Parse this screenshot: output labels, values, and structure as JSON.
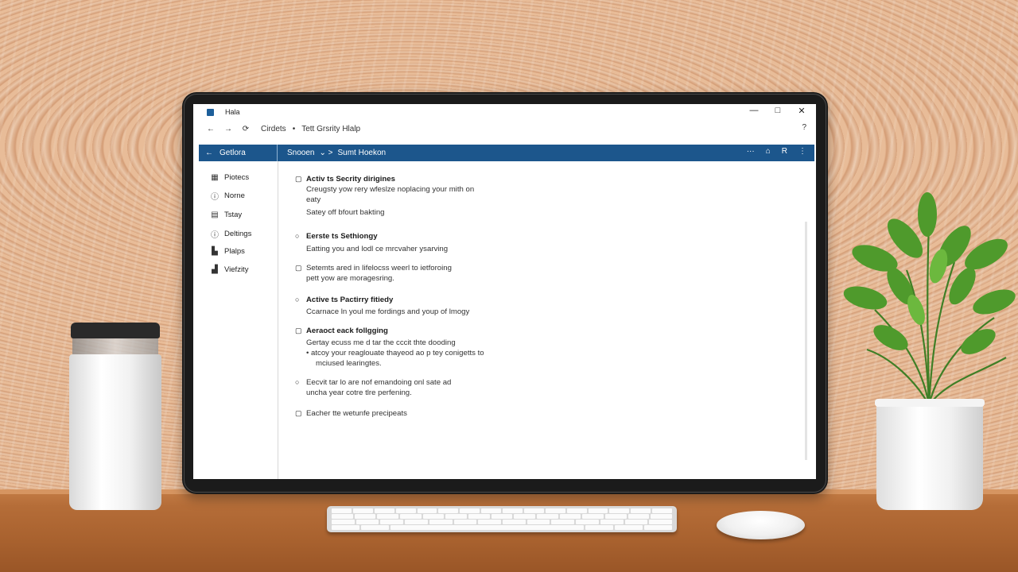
{
  "window": {
    "title": "Hala",
    "controls": {
      "minimize": "—",
      "maximize": "□",
      "close": "✕"
    }
  },
  "address": {
    "back": "←",
    "forward": "→",
    "refresh": "⟳",
    "path": [
      "Cirdets",
      "•",
      "Tett Grsrity Hlalp"
    ],
    "right_icon": "?"
  },
  "header": {
    "back": "←",
    "section": "Getlora",
    "crumbs": [
      "Snooen",
      "⌄ >",
      "Sumt Hoekon"
    ],
    "tools": [
      "···",
      "⌂",
      "R",
      "⋮"
    ]
  },
  "sidebar": {
    "items": [
      {
        "label": "Piotecs",
        "icon": "window-icon",
        "glyph": "▦"
      },
      {
        "label": "Norne",
        "icon": "info-icon",
        "glyph": "ⓘ"
      },
      {
        "label": "Tstay",
        "icon": "calendar-icon",
        "glyph": "▤"
      },
      {
        "label": "Deltings",
        "icon": "clock-icon",
        "glyph": "ⓘ"
      },
      {
        "label": "Plalps",
        "icon": "printer-icon",
        "glyph": "▙"
      },
      {
        "label": "Viefzity",
        "icon": "lock-icon",
        "glyph": "▟"
      }
    ]
  },
  "content": {
    "sections": [
      {
        "mark": "▢",
        "title": "Activ ts Secrity dirigines",
        "lines": [
          "Creugsty yow rery wfeslze noplacing your mith on",
          "eaty",
          "Satey off bfourt bakting"
        ]
      },
      {
        "mark": "○",
        "title": "Eerste ts Sethiongy",
        "lines": [
          "Eatting you and lodl ce mrcvaher ysarving"
        ]
      },
      {
        "mark": "▢",
        "title": "",
        "lines": [
          "Setemts ared in Iifelocss weerl to ietforoing",
          "pett yow are moragesring."
        ]
      },
      {
        "mark": "○",
        "title": "Active ts Pactirry fitiedy",
        "lines": [
          "Ccarnace ln youl me fordings and youp of lmogy"
        ]
      },
      {
        "mark": "▢",
        "title": "Aeraoct eack follgging",
        "lines": [
          "Gertay ecuss me d tar the cccit thte dooding"
        ],
        "bullets": [
          "atcoy your reaglouate thayeod ao p tey conigetts to",
          "mciused learingtes."
        ]
      },
      {
        "mark": "○",
        "title": "",
        "lines": [
          "Eecvit tar lo are nof emandoing onl sate ad",
          "uncha year cotre tlre perfening."
        ]
      },
      {
        "mark": "▢",
        "title": "",
        "lines": [
          "Eacher tte wetunfe precipeats"
        ]
      }
    ]
  }
}
